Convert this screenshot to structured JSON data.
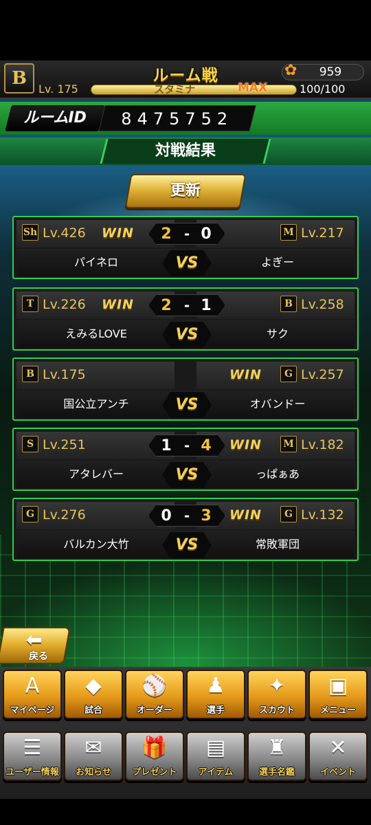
{
  "header": {
    "team_badge": "B",
    "title": "ルーム戦",
    "coins": "959",
    "level": "Lv. 175",
    "stamina_label": "スタミナ",
    "stamina_max": "MAX",
    "stamina_value": "100/100",
    "stamina_fraction": 1.0
  },
  "room": {
    "id_label": "ルームID",
    "id_value": "8475752"
  },
  "section_title": "対戦結果",
  "refresh_label": "更新",
  "vs_label": "VS",
  "win_label": "WIN",
  "matches": [
    {
      "left_icon": "Sh",
      "left_level": "Lv.426",
      "left_name": "パイネロ",
      "left_win": true,
      "score_left": "2",
      "score_right": "0",
      "dash": "-",
      "right_icon": "M",
      "right_level": "Lv.217",
      "right_name": "よぎー",
      "right_win": false
    },
    {
      "left_icon": "T",
      "left_level": "Lv.226",
      "left_name": "えみるLOVE",
      "left_win": true,
      "score_left": "2",
      "score_right": "1",
      "dash": "-",
      "right_icon": "B",
      "right_level": "Lv.258",
      "right_name": "サク",
      "right_win": false
    },
    {
      "left_icon": "B",
      "left_level": "Lv.175",
      "left_name": "国公立アンチ",
      "left_win": false,
      "score_left": "",
      "score_right": "",
      "dash": "",
      "right_icon": "G",
      "right_level": "Lv.257",
      "right_name": "オバンドー",
      "right_win": true
    },
    {
      "left_icon": "S",
      "left_level": "Lv.251",
      "left_name": "アタレバー",
      "left_win": false,
      "score_left": "1",
      "score_right": "4",
      "dash": "-",
      "right_icon": "M",
      "right_level": "Lv.182",
      "right_name": "っぱぁあ",
      "right_win": true
    },
    {
      "left_icon": "G",
      "left_level": "Lv.276",
      "left_name": "バルカン大竹",
      "left_win": false,
      "score_left": "0",
      "score_right": "3",
      "dash": "-",
      "right_icon": "G",
      "right_level": "Lv.132",
      "right_name": "常敗軍団",
      "right_win": true
    }
  ],
  "back_label": "戻る",
  "menu_row1": [
    {
      "label": "マイページ",
      "icon": "A"
    },
    {
      "label": "試合",
      "icon": "◆"
    },
    {
      "label": "オーダー",
      "icon": "⚾"
    },
    {
      "label": "選手",
      "icon": "♟"
    },
    {
      "label": "スカウト",
      "icon": "✦"
    },
    {
      "label": "メニュー",
      "icon": "▣"
    }
  ],
  "menu_row2": [
    {
      "label": "ユーザー情報",
      "icon": "☰"
    },
    {
      "label": "お知らせ",
      "icon": "✉"
    },
    {
      "label": "プレゼント",
      "icon": "🎁"
    },
    {
      "label": "アイテム",
      "icon": "▤"
    },
    {
      "label": "選手名鑑",
      "icon": "♜"
    },
    {
      "label": "イベント",
      "icon": "✕"
    }
  ],
  "colors": {
    "accent_green": "#2fcf55",
    "gold": "#f6d15a",
    "level_gold": "#e9c659"
  }
}
